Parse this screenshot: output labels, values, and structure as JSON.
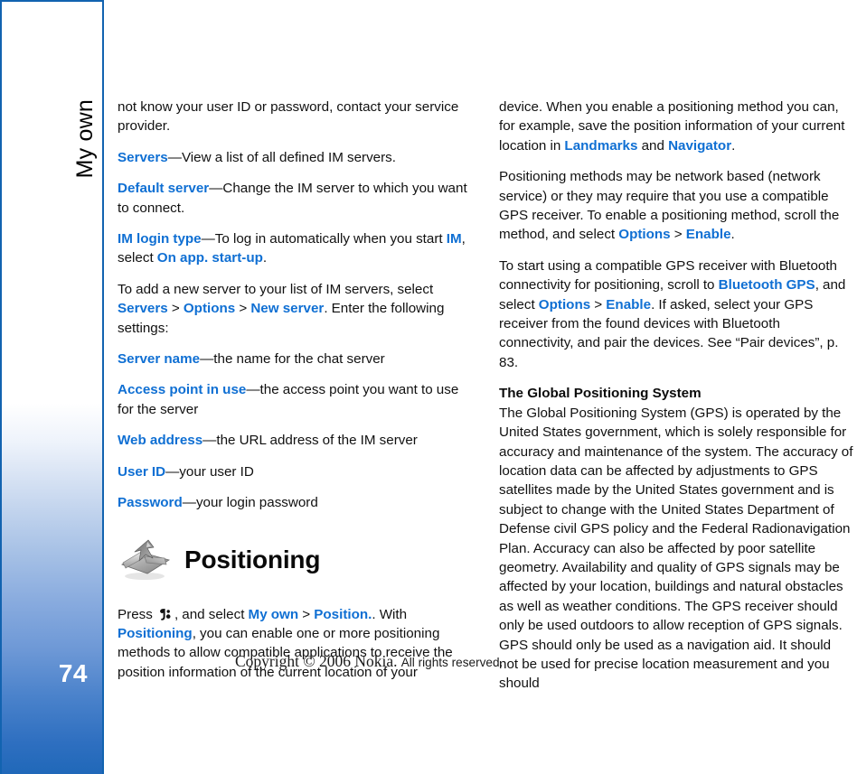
{
  "page": {
    "number": "74",
    "tab_label": "My own",
    "sidebar_accent": "#1263b0",
    "link_color": "#0f6fd3"
  },
  "footer": {
    "copyright_serif": "Copyright © 2006 Nokia.",
    "copyright_sans": "All rights reserved."
  },
  "left_column": {
    "p1": {
      "text": "not know your user ID or password, contact your service provider."
    },
    "p2": {
      "kw1": "Servers",
      "rest": "—View a list of all defined IM servers."
    },
    "p3": {
      "kw1": "Default server",
      "rest": "—Change the IM server to which you want to connect."
    },
    "p4": {
      "kw1": "IM login type",
      "t1": "—To log in automatically when you start ",
      "kw2": "IM",
      "t2": ", select ",
      "kw3": "On app. start-up",
      "t3": "."
    },
    "p5": {
      "t1": "To add a new server to your list of IM servers, select ",
      "kw1": "Servers",
      "gt1": " > ",
      "kw2": "Options",
      "gt2": " > ",
      "kw3": "New server",
      "t2": ". Enter the following settings:"
    },
    "p6": {
      "kw1": "Server name",
      "rest": "—the name for the chat server"
    },
    "p7": {
      "kw1": "Access point in use",
      "rest": "—the access point you want to use for the server"
    },
    "p8": {
      "kw1": "Web address",
      "rest": "—the URL address of the IM server"
    },
    "p9": {
      "kw1": "User ID",
      "rest": "—your user ID"
    },
    "p10": {
      "kw1": "Password",
      "rest": "—your login password"
    },
    "section": {
      "icon_name": "positioning-book-icon",
      "title": "Positioning"
    },
    "p11": {
      "t1": "Press ",
      "icon_name": "nokia-menu-key-icon",
      "t2": ", and select ",
      "kw1": "My own",
      "gt1": " > ",
      "kw2": "Position.",
      "t3": ". With ",
      "kw3": "Positioning",
      "t4": ", you can enable one or more positioning methods to allow compatible applications to receive the position information of the current location of your"
    }
  },
  "right_column": {
    "p1": {
      "t1": "device. When you enable a positioning method you can, for example, save the position information of your current location in ",
      "kw1": "Landmarks",
      "t2": " and ",
      "kw2": "Navigator",
      "t3": "."
    },
    "p2": {
      "t1": "Positioning methods may be network based (network service) or they may require that you use a compatible GPS receiver. To enable a positioning method, scroll the method, and select ",
      "kw1": "Options",
      "gt1": " > ",
      "kw2": "Enable",
      "t2": "."
    },
    "p3": {
      "t1": "To start using a compatible GPS receiver with Bluetooth connectivity for positioning, scroll to ",
      "kw1": "Bluetooth GPS",
      "t2": ", and select ",
      "kw2": "Options",
      "gt1": " > ",
      "kw3": "Enable",
      "t3": ". If asked, select your GPS receiver from the found devices with Bluetooth connectivity, and pair the devices. See “Pair devices”, p. 83."
    },
    "subhead": "The Global Positioning System",
    "p4": {
      "text": "The Global Positioning System (GPS) is operated by the United States government, which is solely responsible for accuracy and maintenance of the system. The accuracy of location data can be affected by adjustments to GPS satellites made by the United States government and is subject to change with the United States Department of Defense civil GPS policy and the Federal Radionavigation Plan. Accuracy can also be affected by poor satellite geometry. Availability and quality of GPS signals may be affected by your location, buildings and natural obstacles as well as weather conditions. The GPS receiver should only be used outdoors to allow reception of GPS signals. GPS should only be used as a navigation aid. It should not be used for precise location measurement and you should"
    }
  }
}
